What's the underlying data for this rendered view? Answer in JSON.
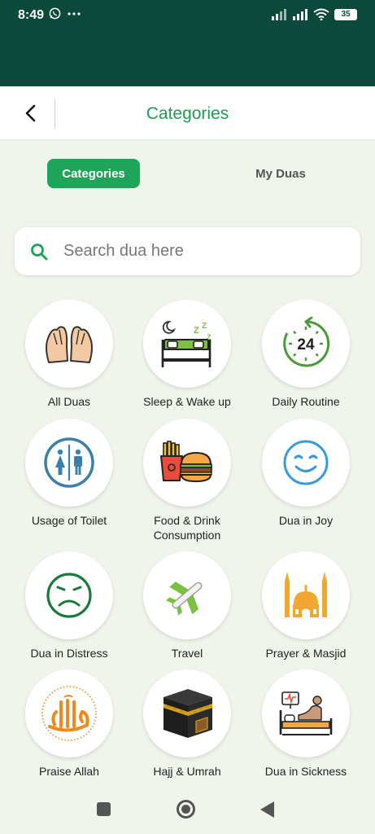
{
  "status_bar": {
    "time": "8:49",
    "battery": "35"
  },
  "header": {
    "title": "Categories"
  },
  "tabs": [
    {
      "label": "Categories"
    },
    {
      "label": "My Duas"
    }
  ],
  "search": {
    "placeholder": "Search dua here",
    "value": ""
  },
  "categories": [
    {
      "label": "All Duas",
      "icon": "praying-hands-icon"
    },
    {
      "label": "Sleep & Wake up",
      "icon": "bed-icon"
    },
    {
      "label": "Daily Routine",
      "icon": "clock-24-icon"
    },
    {
      "label": "Usage of Toilet",
      "icon": "restroom-icon"
    },
    {
      "label": "Food & Drink Consumption",
      "icon": "food-icon"
    },
    {
      "label": "Dua in Joy",
      "icon": "smile-icon"
    },
    {
      "label": "Dua in Distress",
      "icon": "sad-face-icon"
    },
    {
      "label": "Travel",
      "icon": "airplane-icon"
    },
    {
      "label": "Prayer & Masjid",
      "icon": "mosque-icon"
    },
    {
      "label": "Praise Allah",
      "icon": "allah-calligraphy-icon"
    },
    {
      "label": "Hajj & Umrah",
      "icon": "kaaba-icon"
    },
    {
      "label": "Dua in Sickness",
      "icon": "hospital-bed-icon"
    }
  ],
  "clock_icon_text": "24",
  "colors": {
    "primary": "#1fa55a",
    "status_bar": "#0b4a3a",
    "background": "#f0f5ec"
  }
}
